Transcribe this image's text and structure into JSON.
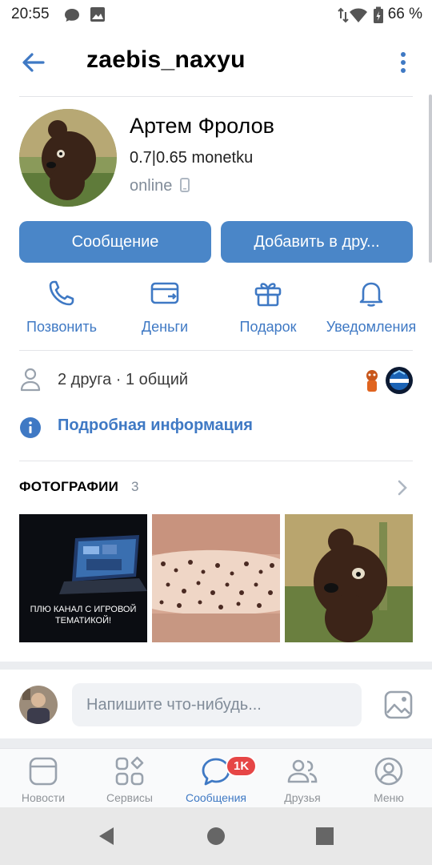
{
  "status_bar": {
    "time": "20:55",
    "battery": "66 %"
  },
  "header": {
    "username": "zaebis_naxyu"
  },
  "profile": {
    "name": "Артем Фролов",
    "status": "0.7|0.65 monetku",
    "online": "online"
  },
  "buttons": {
    "message": "Сообщение",
    "add_friend": "Добавить в дру..."
  },
  "actions": [
    {
      "label": "Позвонить",
      "icon": "phone-icon"
    },
    {
      "label": "Деньги",
      "icon": "money-icon"
    },
    {
      "label": "Подарок",
      "icon": "gift-icon"
    },
    {
      "label": "Уведомления",
      "icon": "bell-icon"
    }
  ],
  "friends": {
    "text": "2 друга · 1 общий"
  },
  "info": {
    "text": "Подробная информация"
  },
  "photos": {
    "title": "ФОТОГРАФИИ",
    "count": "3",
    "items": [
      {
        "caption": "ПЛЮ КАНАЛ С ИГРОВОЙ ТЕМАТИКОЙ!"
      },
      {
        "caption": ""
      },
      {
        "caption": ""
      }
    ]
  },
  "composer": {
    "placeholder": "Напишите что-нибудь..."
  },
  "tabbar": {
    "items": [
      {
        "label": "Новости",
        "icon": "news-icon"
      },
      {
        "label": "Сервисы",
        "icon": "services-icon"
      },
      {
        "label": "Сообщения",
        "icon": "messages-icon",
        "active": true,
        "badge": "1K"
      },
      {
        "label": "Друзья",
        "icon": "friends-icon"
      },
      {
        "label": "Меню",
        "icon": "menu-profile-icon"
      }
    ]
  },
  "colors": {
    "accent": "#4a86c8",
    "link": "#3f79c4",
    "badge": "#e64646"
  }
}
